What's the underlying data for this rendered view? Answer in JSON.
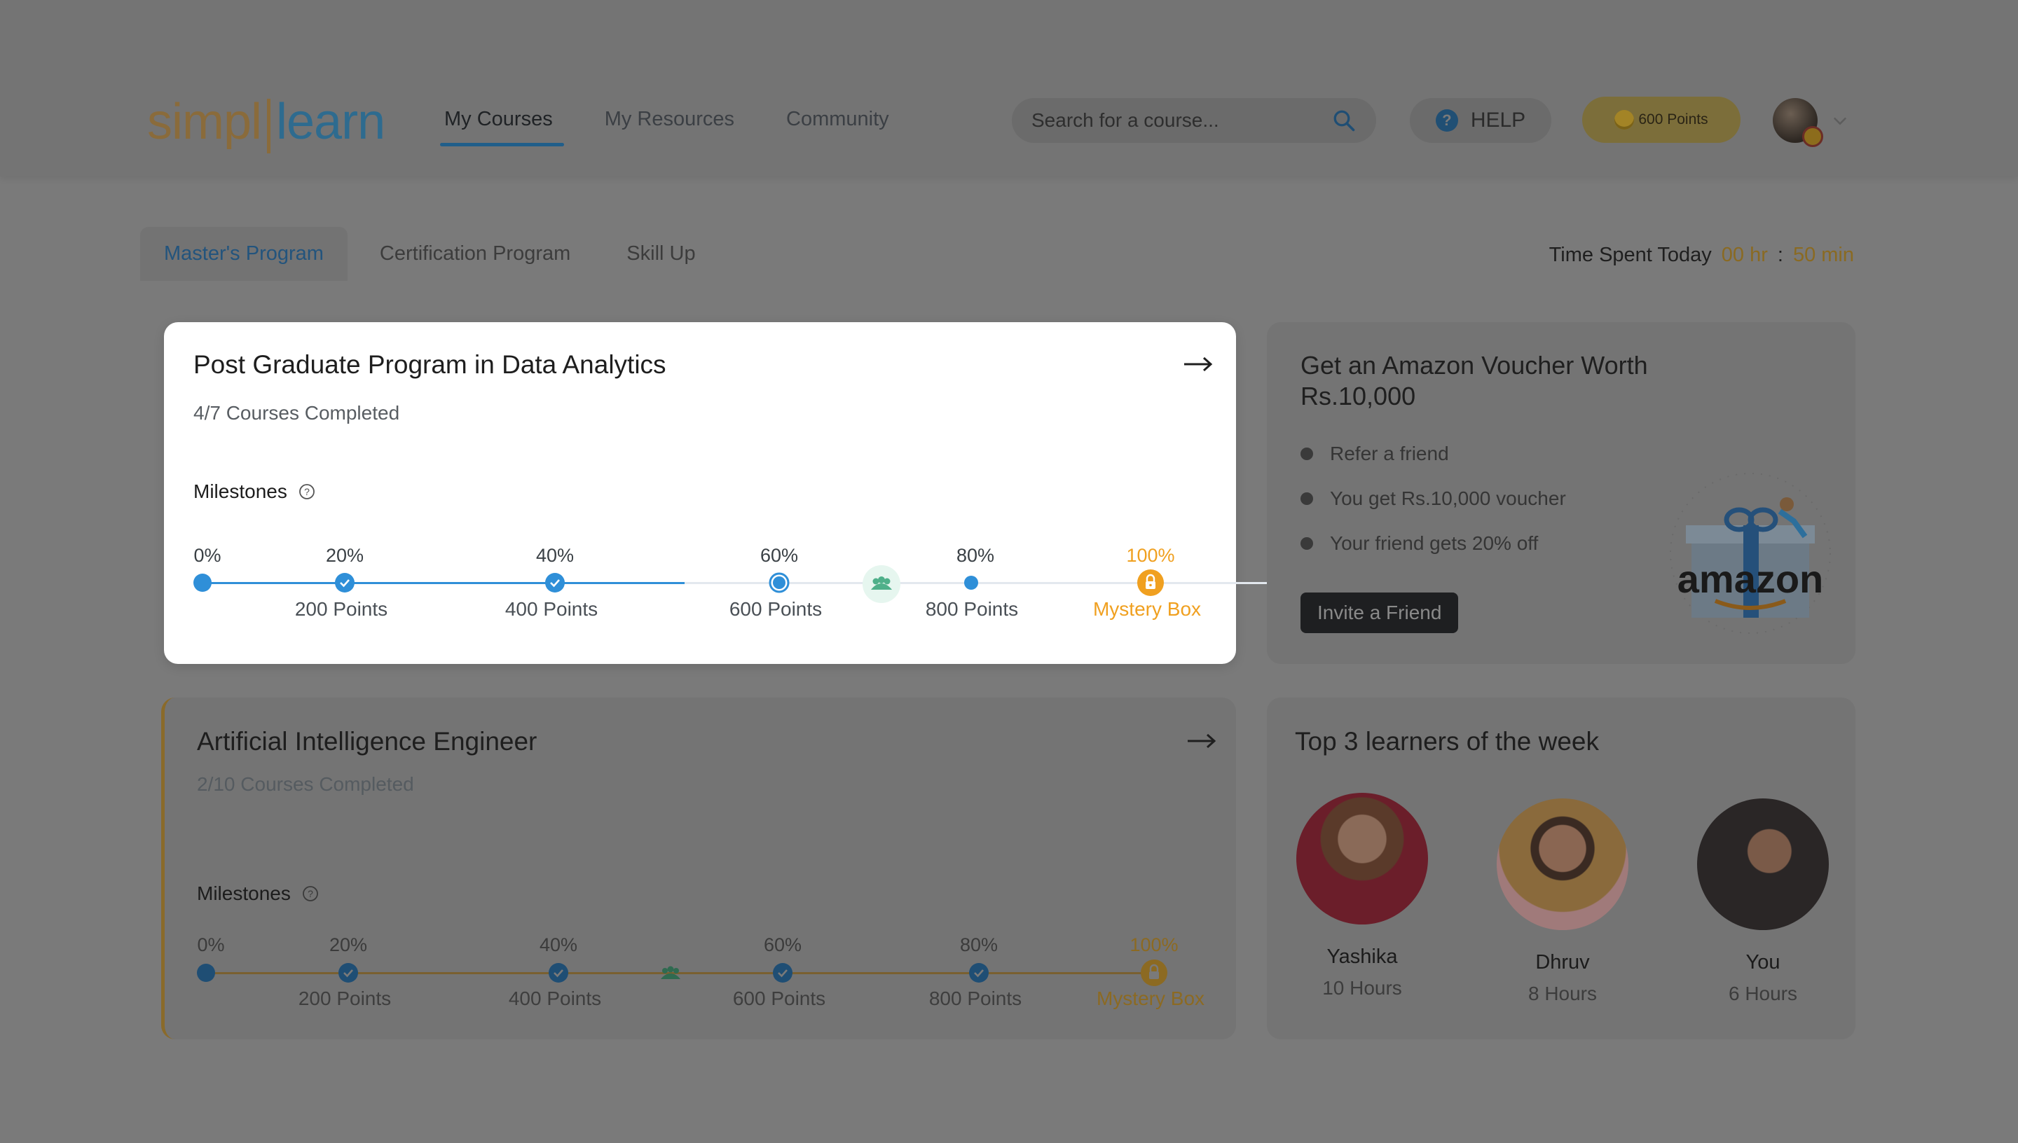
{
  "brand": {
    "logo_left": "simpl",
    "logo_right": "learn"
  },
  "nav": {
    "items": [
      "My Courses",
      "My Resources",
      "Community"
    ],
    "active": "My Courses"
  },
  "search": {
    "placeholder": "Search for a course..."
  },
  "help": {
    "label": "HELP"
  },
  "points": {
    "label": "600 Points"
  },
  "tabs": {
    "items": [
      "Master's Program",
      "Certification Program",
      "Skill Up"
    ],
    "active": "Master's Program"
  },
  "time_spent": {
    "label": "Time Spent Today",
    "hours": "00 hr",
    "separator": ":",
    "minutes": "50 min"
  },
  "programs": [
    {
      "title": "Post Graduate Program in Data Analytics",
      "completed": "4/7 Courses Completed",
      "milestones_label": "Milestones",
      "percentages": [
        "0%",
        "20%",
        "40%",
        "60%",
        "80%",
        "100%"
      ],
      "points": [
        "200 Points",
        "400 Points",
        "600 Points",
        "800 Points",
        "Mystery Box"
      ],
      "progress_fraction": 0.57
    },
    {
      "title": "Artificial Intelligence Engineer",
      "completed": "2/10 Courses Completed",
      "milestones_label": "Milestones",
      "percentages": [
        "0%",
        "20%",
        "40%",
        "60%",
        "80%",
        "100%"
      ],
      "points": [
        "200 Points",
        "400 Points",
        "600 Points",
        "800 Points",
        "Mystery Box"
      ],
      "progress_fraction": 0.2
    }
  ],
  "voucher": {
    "title_line1": "Get an Amazon Voucher Worth",
    "title_line2": "Rs.10,000",
    "bullets": [
      "Refer a friend",
      "You get Rs.10,000 voucher",
      "Your friend gets 20% off"
    ],
    "button": "Invite a Friend",
    "brand_text": "amazon"
  },
  "top_learners": {
    "title": "Top 3 learners of the week",
    "learners": [
      {
        "name": "Yashika",
        "hours": "10 Hours"
      },
      {
        "name": "Dhruv",
        "hours": "8 Hours"
      },
      {
        "name": "You",
        "hours": "6 Hours"
      }
    ]
  },
  "colors": {
    "accent_blue": "#2f8fd8",
    "mystery_orange": "#f0a020",
    "community_green": "#4fb08a",
    "overlay": "#7a7a7a"
  }
}
